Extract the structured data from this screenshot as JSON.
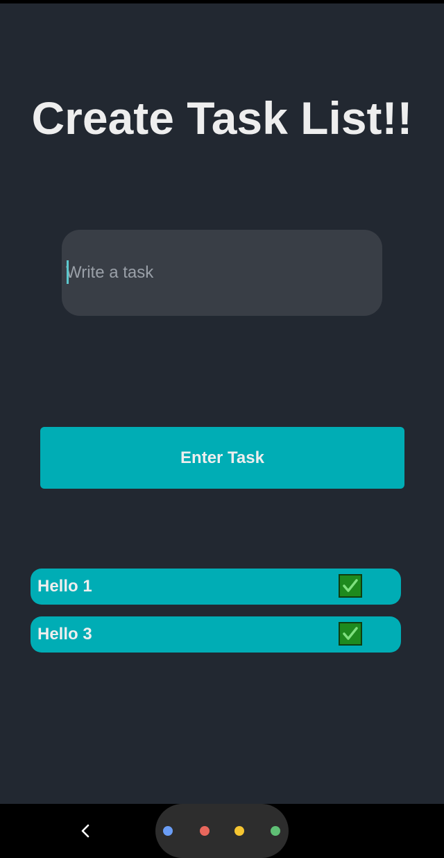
{
  "header": {
    "title": "Create Task List!!"
  },
  "task_input": {
    "placeholder": "Write a task",
    "value": ""
  },
  "enter_button": {
    "label": "Enter Task"
  },
  "tasks": [
    {
      "label": "Hello 1",
      "done": true
    },
    {
      "label": "Hello 3",
      "done": true
    }
  ],
  "colors": {
    "background": "#222831",
    "input_background": "#393E46",
    "accent": "#00ADB5",
    "text": "#EEEEEE",
    "check": "#1e8a1e"
  },
  "navbar": {
    "icons": [
      "back-icon",
      "home-pill-icon"
    ],
    "dot_colors": [
      "#6a9df5",
      "#e8675c",
      "#f5c531",
      "#5fbf75"
    ]
  }
}
